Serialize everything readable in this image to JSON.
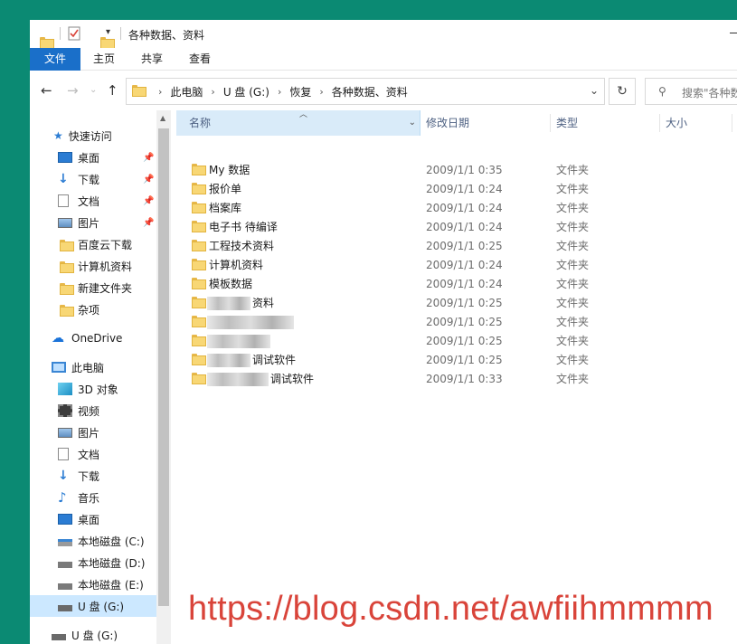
{
  "window": {
    "title": "各种数据、资料"
  },
  "ribbon": {
    "tabs": [
      {
        "label": "文件",
        "active": true
      },
      {
        "label": "主页"
      },
      {
        "label": "共享"
      },
      {
        "label": "查看"
      }
    ]
  },
  "address": {
    "crumbs": [
      "此电脑",
      "U 盘 (G:)",
      "恢复",
      "各种数据、资料"
    ]
  },
  "search": {
    "placeholder": "搜索\"各种数"
  },
  "nav": {
    "quick_access": "快速访问",
    "items": [
      {
        "label": "桌面",
        "icon": "desktop-icon",
        "pinned": true
      },
      {
        "label": "下载",
        "icon": "download-icon",
        "pinned": true
      },
      {
        "label": "文档",
        "icon": "document-icon",
        "pinned": true
      },
      {
        "label": "图片",
        "icon": "picture-icon",
        "pinned": true
      },
      {
        "label": "百度云下载",
        "icon": "folder-icon"
      },
      {
        "label": "计算机资料",
        "icon": "folder-icon"
      },
      {
        "label": "新建文件夹",
        "icon": "folder-icon"
      },
      {
        "label": "杂项",
        "icon": "folder-icon"
      }
    ],
    "onedrive": "OneDrive",
    "this_pc": "此电脑",
    "pc_items": [
      {
        "label": "3D 对象",
        "icon": "3d-objects-icon"
      },
      {
        "label": "视频",
        "icon": "video-icon"
      },
      {
        "label": "图片",
        "icon": "picture-icon"
      },
      {
        "label": "文档",
        "icon": "document-icon"
      },
      {
        "label": "下载",
        "icon": "download-icon"
      },
      {
        "label": "音乐",
        "icon": "music-icon"
      },
      {
        "label": "桌面",
        "icon": "desktop-icon"
      },
      {
        "label": "本地磁盘 (C:)",
        "icon": "system-drive-icon"
      },
      {
        "label": "本地磁盘 (D:)",
        "icon": "drive-icon"
      },
      {
        "label": "本地磁盘 (E:)",
        "icon": "drive-icon"
      },
      {
        "label": "U 盘 (G:)",
        "icon": "usb-drive-icon",
        "selected": true
      }
    ],
    "usb_root": "U 盘 (G:)"
  },
  "columns": {
    "name": "名称",
    "date": "修改日期",
    "type": "类型",
    "size": "大小"
  },
  "files": [
    {
      "name": "My 数据",
      "date": "2009/1/1 0:35",
      "type": "文件夹"
    },
    {
      "name": "报价单",
      "date": "2009/1/1 0:24",
      "type": "文件夹"
    },
    {
      "name": "档案库",
      "date": "2009/1/1 0:24",
      "type": "文件夹"
    },
    {
      "name": "电子书 待编译",
      "date": "2009/1/1 0:24",
      "type": "文件夹"
    },
    {
      "name": "工程技术资料",
      "date": "2009/1/1 0:25",
      "type": "文件夹"
    },
    {
      "name": "计算机资料",
      "date": "2009/1/1 0:24",
      "type": "文件夹"
    },
    {
      "name": "模板数据",
      "date": "2009/1/1 0:24",
      "type": "文件夹"
    },
    {
      "name": "资料",
      "date": "2009/1/1 0:25",
      "type": "文件夹",
      "blurred_prefix": true
    },
    {
      "name": "",
      "date": "2009/1/1 0:25",
      "type": "文件夹",
      "blurred_full": true
    },
    {
      "name": "",
      "date": "2009/1/1 0:25",
      "type": "文件夹",
      "blurred_full": true
    },
    {
      "name": "调试软件",
      "date": "2009/1/1 0:25",
      "type": "文件夹",
      "blurred_prefix": true
    },
    {
      "name": "调试软件",
      "date": "2009/1/1 0:33",
      "type": "文件夹",
      "blurred_prefix": true
    }
  ],
  "watermark": "https://blog.csdn.net/awfiihmmmm"
}
